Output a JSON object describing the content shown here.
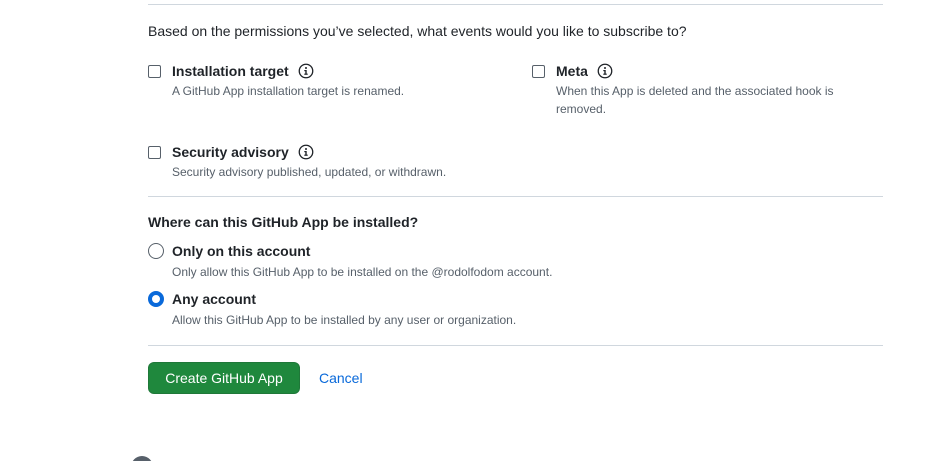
{
  "subscribe": {
    "prompt": "Based on the permissions you’ve selected, what events would you like to subscribe to?",
    "events": [
      {
        "title": "Installation target",
        "description": "A GitHub App installation target is renamed.",
        "checked": false
      },
      {
        "title": "Meta",
        "description": "When this App is deleted and the associated hook is removed.",
        "checked": false
      },
      {
        "title": "Security advisory",
        "description": "Security advisory published, updated, or withdrawn.",
        "checked": false
      }
    ]
  },
  "install_location": {
    "title": "Where can this GitHub App be installed?",
    "options": [
      {
        "label": "Only on this account",
        "description": "Only allow this GitHub App to be installed on the @rodolfodom account.",
        "selected": false
      },
      {
        "label": "Any account",
        "description": "Allow this GitHub App to be installed by any user or organization.",
        "selected": true
      }
    ]
  },
  "actions": {
    "create_label": "Create GitHub App",
    "cancel_label": "Cancel"
  },
  "colors": {
    "primary_button": "#1f883d",
    "link": "#0969da",
    "radio_selected": "#0969da",
    "muted_text": "#57606a",
    "border": "#d0d7de"
  },
  "icons": {
    "info": "info-icon"
  }
}
